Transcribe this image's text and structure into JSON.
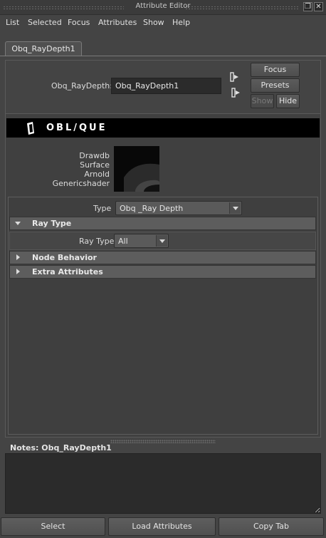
{
  "window": {
    "title": "Attribute Editor",
    "controls": [
      "restore-icon",
      "close-icon"
    ]
  },
  "menu": [
    "List",
    "Selected",
    "Focus",
    "Attributes",
    "Show",
    "Help"
  ],
  "tab": {
    "label": "Obq_RayDepth1"
  },
  "node": {
    "type_label": "Obq_RayDepth:",
    "name_value": "Obq_RayDepth1"
  },
  "side_buttons": {
    "focus": "Focus",
    "presets": "Presets",
    "show": "Show",
    "hide": "Hide"
  },
  "banner": {
    "logo_text": "OBL/QUE"
  },
  "classification": [
    "Drawdb",
    "Surface",
    "Arnold",
    "Genericshader"
  ],
  "type_row": {
    "label": "Type",
    "value": "Obq _Ray Depth"
  },
  "sections": [
    {
      "label": "Ray Type",
      "expanded": true
    },
    {
      "label": "Node Behavior",
      "expanded": false
    },
    {
      "label": "Extra Attributes",
      "expanded": false
    }
  ],
  "ray_type": {
    "label": "Ray Type",
    "value": "All"
  },
  "notes": {
    "label": "Notes:",
    "node": "Obq_RayDepth1"
  },
  "bottom_buttons": {
    "select": "Select",
    "load": "Load Attributes",
    "copy": "Copy Tab"
  },
  "colors": {
    "background": "#444444",
    "field": "#2b2b2b",
    "section_header": "#5d5d5d",
    "banner": "#000000"
  }
}
